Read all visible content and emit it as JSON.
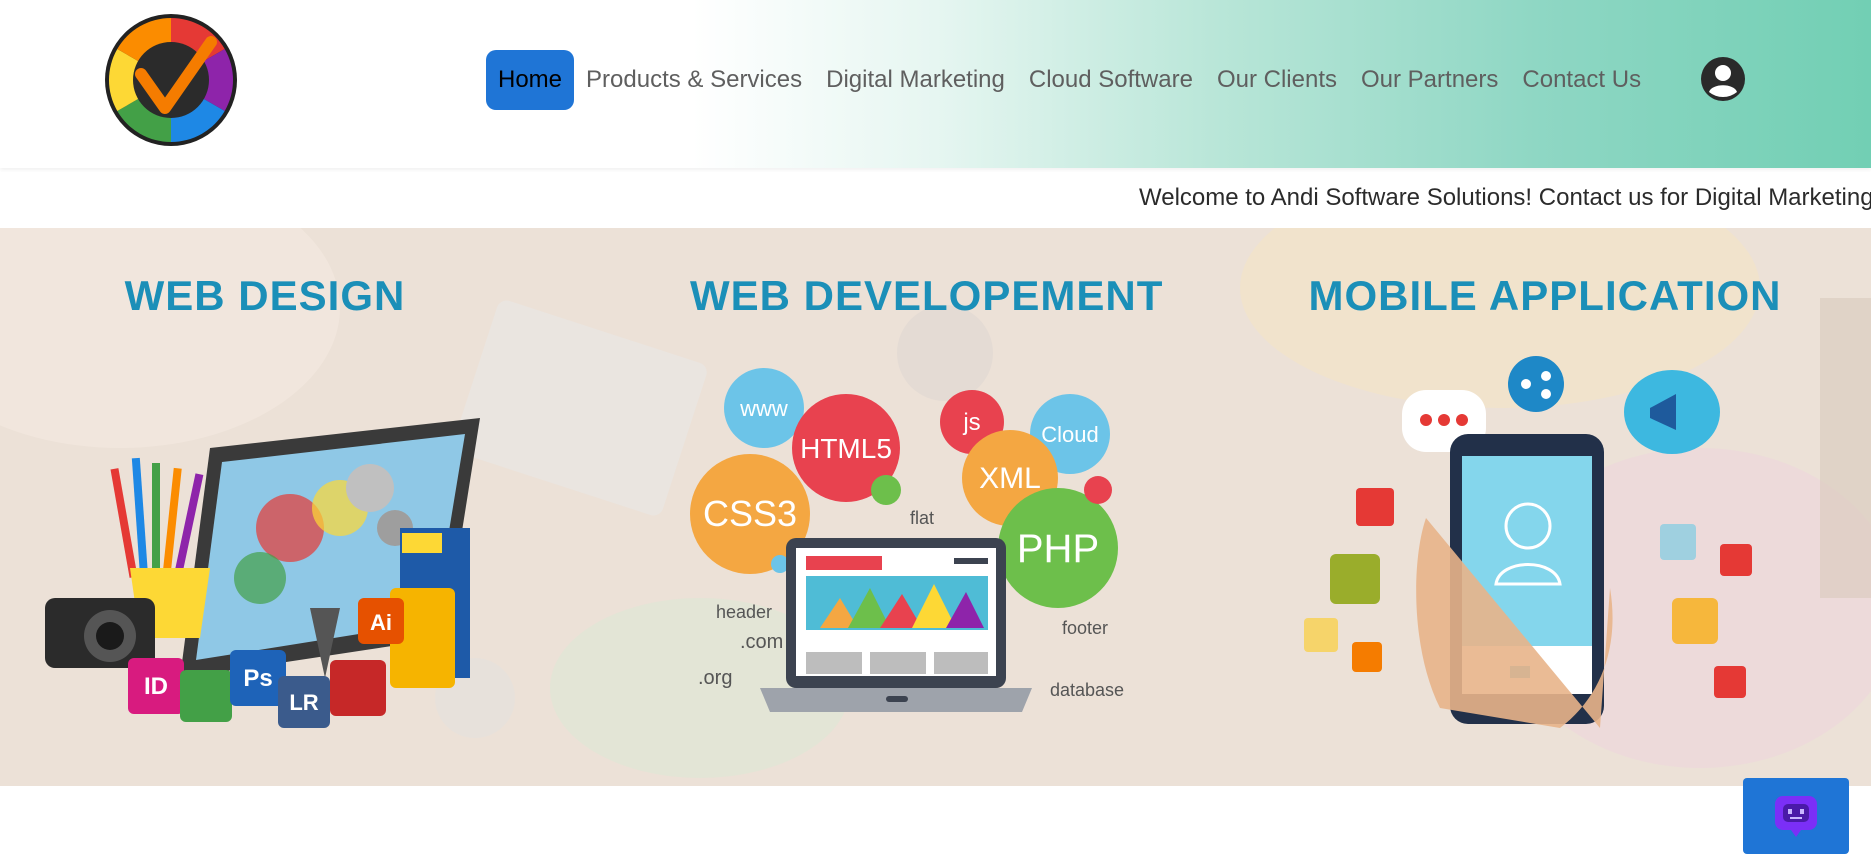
{
  "header": {
    "logo_name": "andi-logo",
    "nav": [
      {
        "label": "Home",
        "active": true
      },
      {
        "label": "Products & Services",
        "active": false
      },
      {
        "label": "Digital Marketing",
        "active": false
      },
      {
        "label": "Cloud Software",
        "active": false
      },
      {
        "label": "Our Clients",
        "active": false
      },
      {
        "label": "Our Partners",
        "active": false
      },
      {
        "label": "Contact Us",
        "active": false
      }
    ],
    "user_icon": "user-circle-icon"
  },
  "marquee": {
    "text": "Welcome to Andi Software Solutions! Contact us for Digital Marketing"
  },
  "hero": {
    "services": [
      {
        "title": "WEB DESIGN"
      },
      {
        "title": "WEB DEVELOPEMENT"
      },
      {
        "title": "MOBILE APPLICATION"
      }
    ],
    "web_design_art": {
      "labels": [
        "ID",
        "Ps",
        "LR",
        "Ai"
      ]
    },
    "web_dev_art": {
      "bubbles": [
        "www",
        "HTML5",
        "js",
        "Cloud",
        "XML",
        "CSS3",
        "PHP"
      ],
      "words": [
        "flat",
        "header",
        ".com",
        ".org",
        "footer",
        "database"
      ]
    }
  },
  "colors": {
    "accent": "#1f75d6",
    "title_blue": "#1b8fb8",
    "chat_icon": "#7b2ff7"
  },
  "chat_widget": {
    "icon": "chat-bot-icon"
  }
}
